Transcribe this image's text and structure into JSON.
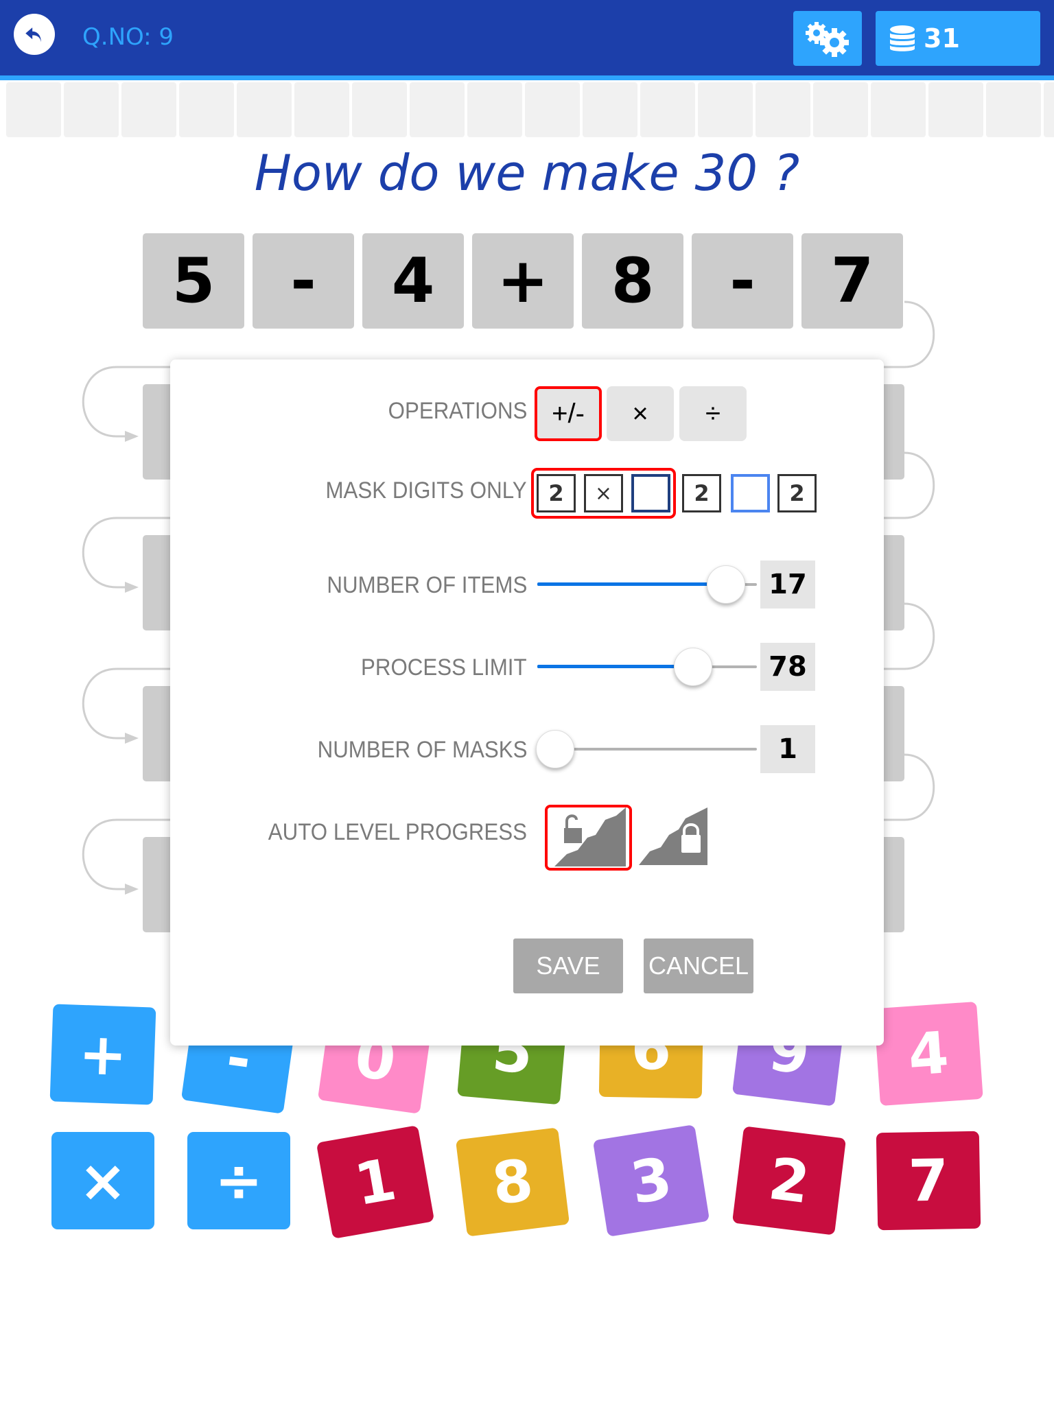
{
  "header": {
    "question_label": "Q.NO: 9",
    "coins": "31",
    "colors": {
      "bar": "#1c3faa",
      "accent": "#2ea4fd"
    }
  },
  "progress": {
    "cells_total": 19,
    "cells_filled": 0
  },
  "question": {
    "title": "How do we make 30 ?"
  },
  "equation": {
    "tiles": [
      "5",
      "-",
      "4",
      "+",
      "8",
      "-",
      "7"
    ]
  },
  "settings": {
    "operations": {
      "label": "OPERATIONS",
      "options": [
        {
          "symbol": "+/-",
          "selected": true
        },
        {
          "symbol": "×",
          "selected": false
        },
        {
          "symbol": "÷",
          "selected": false
        }
      ]
    },
    "mask_digits": {
      "label": "MASK DIGITS ONLY",
      "options": [
        {
          "boxes": [
            "2",
            "×",
            ""
          ],
          "selected": true
        },
        {
          "boxes": [
            "2",
            "",
            "2"
          ],
          "selected": false
        }
      ]
    },
    "number_of_items": {
      "label": "NUMBER OF ITEMS",
      "value": "17",
      "fraction": 0.86
    },
    "process_limit": {
      "label": "PROCESS LIMIT",
      "value": "78",
      "fraction": 0.71
    },
    "number_of_masks": {
      "label": "NUMBER OF MASKS",
      "value": "1",
      "fraction": 0.08
    },
    "auto_level": {
      "label": "AUTO LEVEL PROGRESS",
      "options": [
        {
          "name": "unlocked",
          "selected": true
        },
        {
          "name": "locked",
          "selected": false
        }
      ]
    },
    "save_label": "SAVE",
    "cancel_label": "CANCEL"
  },
  "keypad": {
    "row1": [
      {
        "label": "+",
        "color": "#2ea4fd"
      },
      {
        "label": "-",
        "color": "#2ea4fd"
      },
      {
        "label": "0",
        "color": "#ff8ac8"
      },
      {
        "label": "5",
        "color": "#669d26"
      },
      {
        "label": "6",
        "color": "#e8b126"
      },
      {
        "label": "9",
        "color": "#a274e3"
      },
      {
        "label": "4",
        "color": "#ff8ac8"
      }
    ],
    "row2": [
      {
        "label": "×",
        "color": "#2ea4fd"
      },
      {
        "label": "÷",
        "color": "#2ea4fd"
      },
      {
        "label": "1",
        "color": "#c80d3f"
      },
      {
        "label": "8",
        "color": "#e8b126"
      },
      {
        "label": "3",
        "color": "#a274e3"
      },
      {
        "label": "2",
        "color": "#c80d3f"
      },
      {
        "label": "7",
        "color": "#c80d3f"
      }
    ]
  }
}
